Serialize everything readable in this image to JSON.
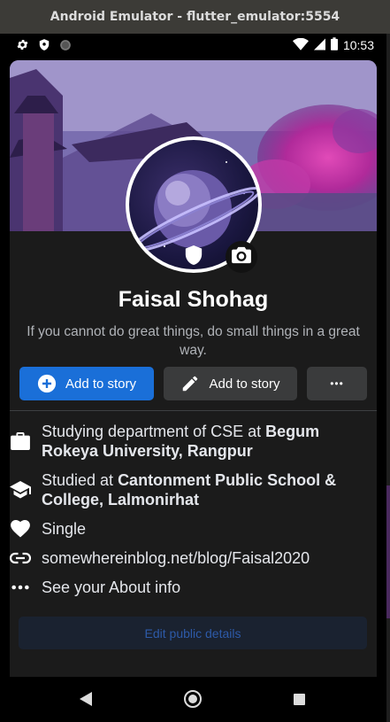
{
  "window": {
    "title": "Android Emulator - flutter_emulator:5554"
  },
  "status_bar": {
    "time": "10:53",
    "left_icons": [
      "settings-icon",
      "shield-icon",
      "circle-dot-icon"
    ],
    "right_icons": [
      "wifi-icon",
      "signal-icon",
      "battery-icon"
    ]
  },
  "profile": {
    "name": "Faisal Shohag",
    "bio": "If you cannot do great things, do small things in a great way."
  },
  "actions": {
    "primary_label": "Add to story",
    "secondary_label": "Add to story",
    "more_label": "•••",
    "primary_color": "#1a6fd8",
    "secondary_color": "#3a3b3c"
  },
  "about": {
    "work": {
      "prefix": "Studying department of CSE at ",
      "bold": "Begum Rokeya University, Rangpur"
    },
    "education": {
      "prefix": "Studied at ",
      "bold": "Cantonment Public School & College, Lalmonirhat"
    },
    "relationship": "Single",
    "website": "somewhereinblog.net/blog/Faisal2020",
    "see_about": "See your About info"
  },
  "edit_button": {
    "label": "Edit public details"
  },
  "nav_bar": {
    "icons": [
      "back-icon",
      "home-icon",
      "recents-icon"
    ]
  }
}
